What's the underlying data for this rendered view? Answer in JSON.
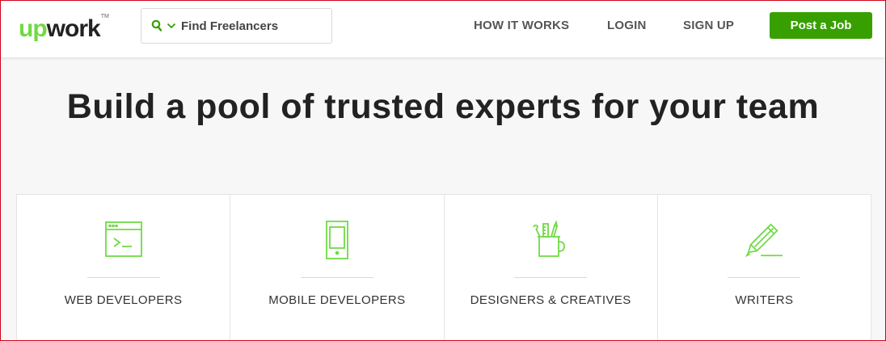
{
  "brand": {
    "logo_up": "up",
    "logo_work": "work",
    "logo_tm": "TM",
    "accent": "#37a000",
    "logo_green": "#6fda44"
  },
  "search": {
    "label": "Find Freelancers",
    "icons": [
      "search-icon",
      "chevron-down-icon"
    ]
  },
  "nav": {
    "how_it_works": "HOW IT WORKS",
    "login": "LOGIN",
    "signup": "SIGN UP",
    "post_job": "Post a Job"
  },
  "hero": {
    "title": "Build a pool of trusted experts for your team"
  },
  "categories": [
    {
      "label": "WEB DEVELOPERS",
      "icon": "browser-terminal-icon"
    },
    {
      "label": "MOBILE DEVELOPERS",
      "icon": "mobile-phone-icon"
    },
    {
      "label": "DESIGNERS & CREATIVES",
      "icon": "pencil-cup-icon"
    },
    {
      "label": "WRITERS",
      "icon": "pencil-icon"
    }
  ]
}
